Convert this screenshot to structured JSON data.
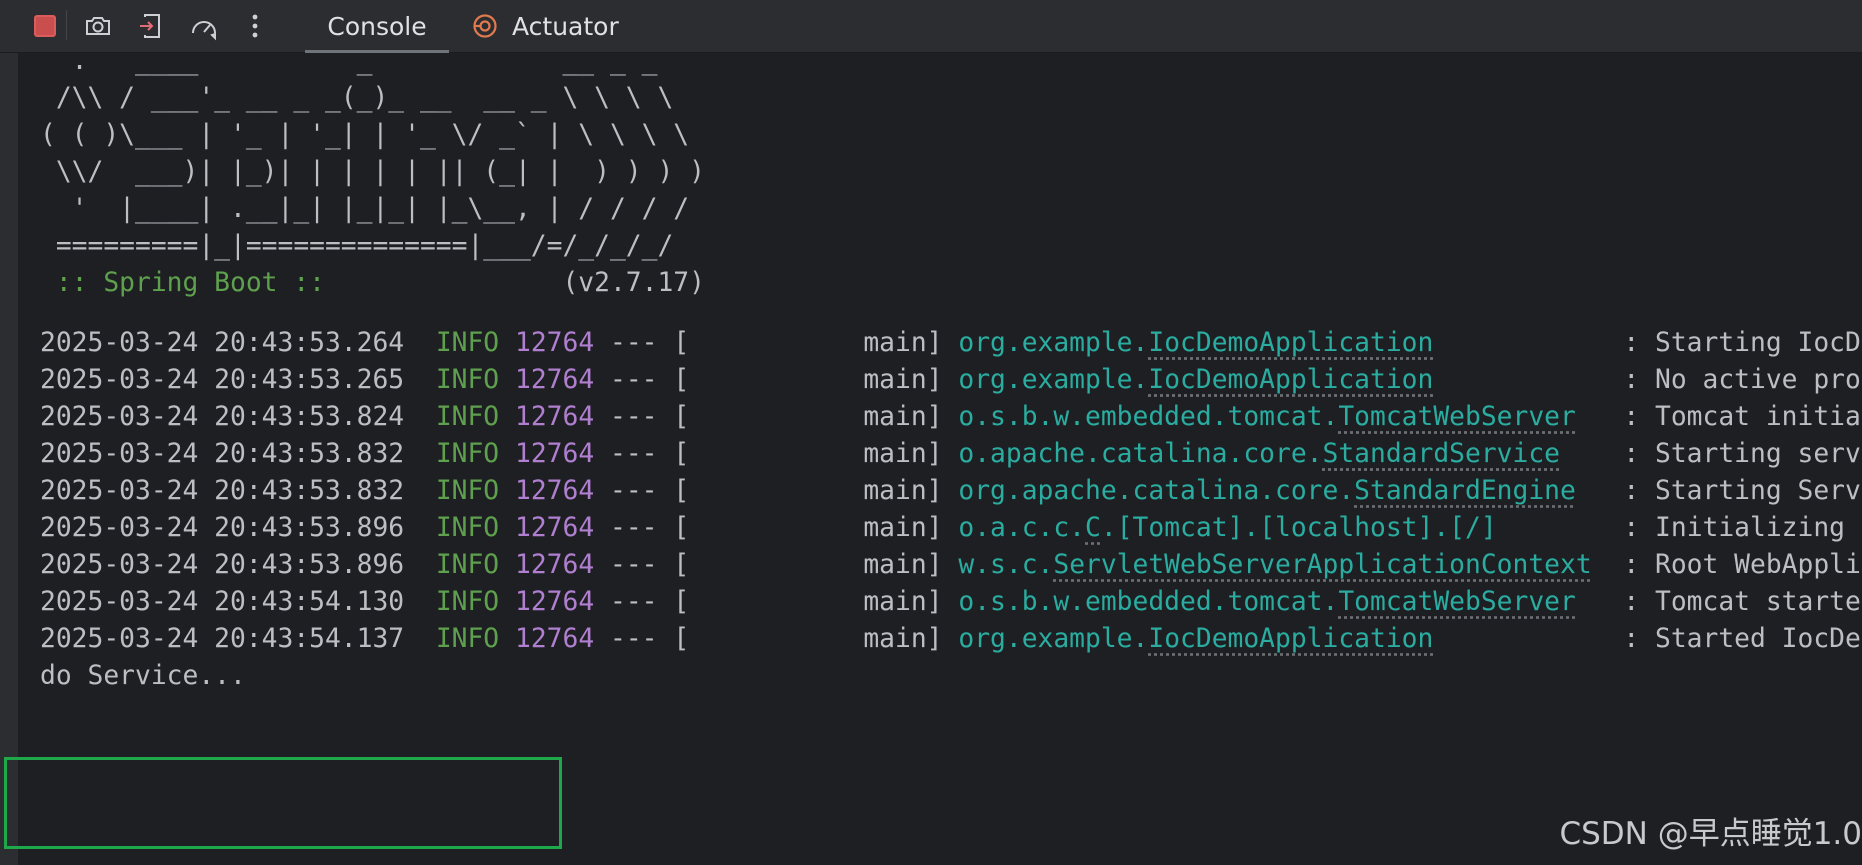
{
  "toolbar": {
    "icons": [
      "stop-icon",
      "camera-icon",
      "exit-icon",
      "speedometer-icon",
      "more-vertical-icon"
    ],
    "tabs": [
      {
        "label": "Console",
        "active": true
      },
      {
        "label": "Actuator",
        "active": false,
        "icon": "actuator-icon"
      }
    ]
  },
  "colors": {
    "background": "#1e1f22",
    "toolbar": "#2b2d30",
    "green": "#5fa04e",
    "purple": "#b07fd0",
    "teal": "#2aaca0",
    "highlight_box": "#1fa84a",
    "stop": "#c94f4f"
  },
  "banner": [
    "  .   ____          _            __ _ _",
    " /\\\\ / ___'_ __ _ _(_)_ __  __ _ \\ \\ \\ \\",
    "( ( )\\___ | '_ | '_| | '_ \\/ _` | \\ \\ \\ \\",
    " \\\\/  ___)| |_)| | | | | || (_| |  ) ) ) )",
    "  '  |____| .__|_| |_|_| |_\\__, | / / / /",
    " =========|_|==============|___/=/_/_/_/"
  ],
  "spring_boot": {
    "label": " :: Spring Boot ::",
    "version": "(v2.7.17)"
  },
  "logs": [
    {
      "ts": "2025-03-24 20:43:53.264",
      "level": "INFO",
      "pid": "12764",
      "sep": "--- [",
      "thread": "           main]",
      "pkg": "org.example.",
      "cls": "IocDemoApplication",
      "pad": "           ",
      "msg": ": Starting IocD"
    },
    {
      "ts": "2025-03-24 20:43:53.265",
      "level": "INFO",
      "pid": "12764",
      "sep": "--- [",
      "thread": "           main]",
      "pkg": "org.example.",
      "cls": "IocDemoApplication",
      "pad": "           ",
      "msg": ": No active pro"
    },
    {
      "ts": "2025-03-24 20:43:53.824",
      "level": "INFO",
      "pid": "12764",
      "sep": "--- [",
      "thread": "           main]",
      "pkg": "o.s.b.w.embedded.tomcat.",
      "cls": "TomcatWebServer",
      "pad": "  ",
      "msg": ": Tomcat initia"
    },
    {
      "ts": "2025-03-24 20:43:53.832",
      "level": "INFO",
      "pid": "12764",
      "sep": "--- [",
      "thread": "           main]",
      "pkg": "o.apache.catalina.core.",
      "cls": "StandardService",
      "pad": "   ",
      "msg": ": Starting serv"
    },
    {
      "ts": "2025-03-24 20:43:53.832",
      "level": "INFO",
      "pid": "12764",
      "sep": "--- [",
      "thread": "           main]",
      "pkg": "org.apache.catalina.core.",
      "cls": "StandardEngine",
      "pad": "  ",
      "msg": ": Starting Serv"
    },
    {
      "ts": "2025-03-24 20:43:53.896",
      "level": "INFO",
      "pid": "12764",
      "sep": "--- [",
      "thread": "           main]",
      "pkg": "o.a.c.c.",
      "cls": "C",
      "pad": "",
      "pkg2": ".[Tomcat].[localhost].[/]",
      "pad2": "       ",
      "msg": ": Initializing "
    },
    {
      "ts": "2025-03-24 20:43:53.896",
      "level": "INFO",
      "pid": "12764",
      "sep": "--- [",
      "thread": "           main]",
      "pkg": "w.s.c.",
      "cls": "ServletWebServerApplicationContext",
      "pad": " ",
      "msg": ": Root WebAppli"
    },
    {
      "ts": "2025-03-24 20:43:54.130",
      "level": "INFO",
      "pid": "12764",
      "sep": "--- [",
      "thread": "           main]",
      "pkg": "o.s.b.w.embedded.tomcat.",
      "cls": "TomcatWebServer",
      "pad": "  ",
      "msg": ": Tomcat starte"
    },
    {
      "ts": "2025-03-24 20:43:54.137",
      "level": "INFO",
      "pid": "12764",
      "sep": "--- [",
      "thread": "           main]",
      "pkg": "org.example.",
      "cls": "IocDemoApplication",
      "pad": "           ",
      "msg": ": Started IocDe"
    }
  ],
  "output_line": "do Service...",
  "watermark": "CSDN @早点睡觉1.0"
}
